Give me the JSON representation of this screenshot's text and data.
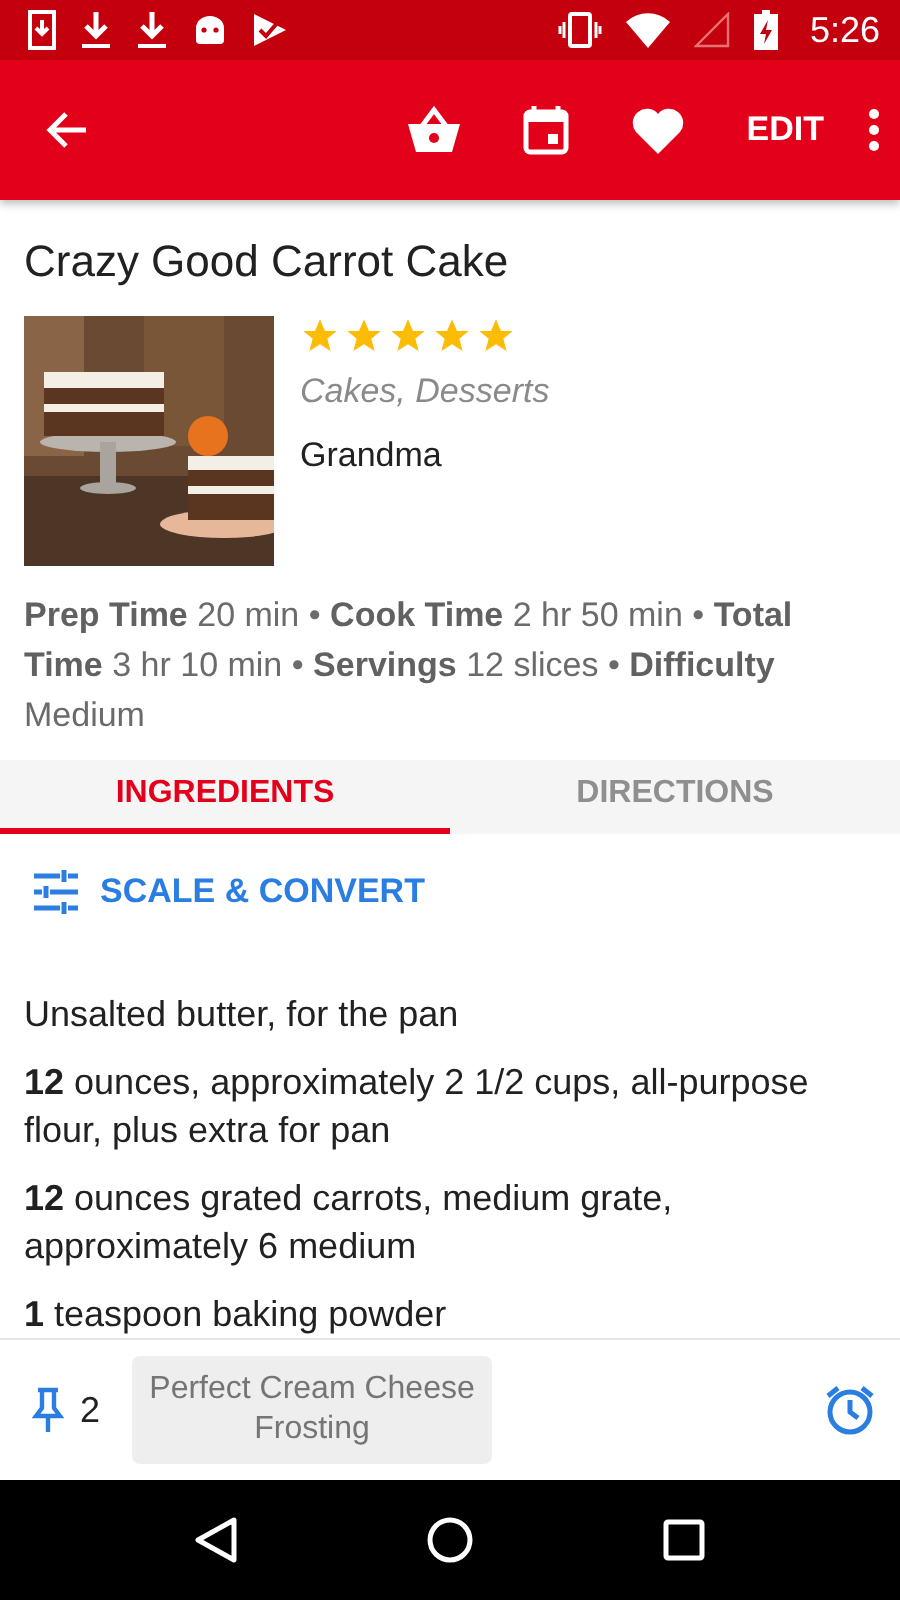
{
  "status_bar": {
    "time": "5:26"
  },
  "toolbar": {
    "actions": [
      {
        "kind": "basket"
      },
      {
        "kind": "calendar"
      },
      {
        "kind": "heart"
      },
      {
        "kind": "text",
        "label": "EDIT"
      },
      {
        "kind": "more"
      }
    ]
  },
  "recipe": {
    "title": "Crazy Good Carrot Cake",
    "stars": 5,
    "categories": "Cakes, Desserts",
    "source": "Grandma",
    "details": "**Prep Time** 20 min • **Cook Time** 2 hr 50 min • **Total Time** 3 hr 10 min • **Servings** 12 slices • **Difficulty** Medium"
  },
  "tabs": [
    {
      "label": "INGREDIENTS",
      "selected": true
    },
    {
      "label": "DIRECTIONS",
      "selected": false
    }
  ],
  "scale_button": {
    "label": "SCALE & CONVERT"
  },
  "ingredients": [
    "Unsalted butter, for the pan",
    "**12** ounces, approximately 2 1/2 cups, all-purpose flour, plus extra for pan",
    "**12** ounces grated carrots, medium grate, approximately 6 medium",
    "**1** teaspoon baking powder"
  ],
  "footer": {
    "pin_count": "2",
    "linked_recipe": "Perfect Cream Cheese Frosting"
  }
}
